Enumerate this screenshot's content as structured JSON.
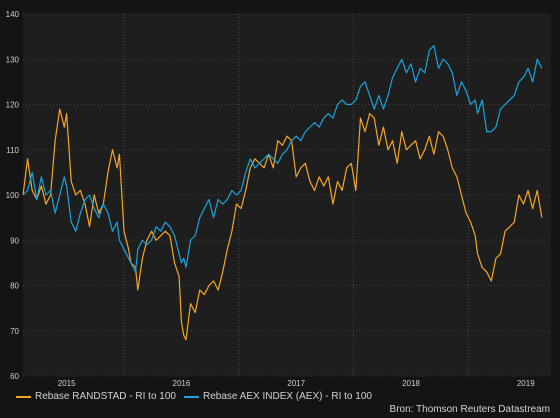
{
  "source_label": "Bron: Thomson Reuters Datastream",
  "chart_data": {
    "type": "line",
    "title": "",
    "xlabel": "",
    "ylabel": "",
    "ylim": [
      60,
      140
    ],
    "yticks": [
      60,
      70,
      80,
      90,
      100,
      110,
      120,
      130,
      140
    ],
    "xlim": [
      2014.62,
      2019.22
    ],
    "year_labels": [
      {
        "x": 2015.0,
        "label": "2015"
      },
      {
        "x": 2016.0,
        "label": "2016"
      },
      {
        "x": 2017.0,
        "label": "2017"
      },
      {
        "x": 2018.0,
        "label": "2018"
      },
      {
        "x": 2019.0,
        "label": "2019"
      }
    ],
    "year_boundaries": [
      2015.5,
      2016.5,
      2017.5,
      2018.5
    ],
    "grid": true,
    "legend_position": "bottom-left",
    "series": [
      {
        "name": "Rebase RANDSTAD - RI to 100",
        "color": "#f5a623",
        "points": [
          [
            2014.62,
            100
          ],
          [
            2014.66,
            108
          ],
          [
            2014.7,
            101
          ],
          [
            2014.74,
            99
          ],
          [
            2014.78,
            102
          ],
          [
            2014.82,
            98
          ],
          [
            2014.86,
            100
          ],
          [
            2014.9,
            112
          ],
          [
            2014.94,
            119
          ],
          [
            2014.98,
            115
          ],
          [
            2015.0,
            118
          ],
          [
            2015.04,
            103
          ],
          [
            2015.08,
            100
          ],
          [
            2015.12,
            101
          ],
          [
            2015.16,
            98
          ],
          [
            2015.2,
            93
          ],
          [
            2015.24,
            100
          ],
          [
            2015.28,
            96
          ],
          [
            2015.32,
            98
          ],
          [
            2015.36,
            105
          ],
          [
            2015.4,
            110
          ],
          [
            2015.44,
            106
          ],
          [
            2015.46,
            109
          ],
          [
            2015.5,
            92
          ],
          [
            2015.54,
            88
          ],
          [
            2015.56,
            85
          ],
          [
            2015.6,
            84
          ],
          [
            2015.62,
            79
          ],
          [
            2015.66,
            86
          ],
          [
            2015.7,
            90
          ],
          [
            2015.74,
            92
          ],
          [
            2015.78,
            90
          ],
          [
            2015.82,
            91
          ],
          [
            2015.86,
            92
          ],
          [
            2015.9,
            91
          ],
          [
            2015.94,
            85
          ],
          [
            2015.98,
            82
          ],
          [
            2016.0,
            72
          ],
          [
            2016.02,
            69
          ],
          [
            2016.04,
            68
          ],
          [
            2016.08,
            76
          ],
          [
            2016.12,
            74
          ],
          [
            2016.16,
            79
          ],
          [
            2016.2,
            78
          ],
          [
            2016.24,
            80
          ],
          [
            2016.28,
            81
          ],
          [
            2016.32,
            79
          ],
          [
            2016.36,
            83
          ],
          [
            2016.4,
            88
          ],
          [
            2016.44,
            92
          ],
          [
            2016.48,
            98
          ],
          [
            2016.52,
            97
          ],
          [
            2016.56,
            101
          ],
          [
            2016.6,
            106
          ],
          [
            2016.64,
            108
          ],
          [
            2016.68,
            107
          ],
          [
            2016.72,
            106
          ],
          [
            2016.76,
            109
          ],
          [
            2016.8,
            106
          ],
          [
            2016.84,
            112
          ],
          [
            2016.88,
            111
          ],
          [
            2016.92,
            113
          ],
          [
            2016.96,
            112
          ],
          [
            2017.0,
            104
          ],
          [
            2017.04,
            106
          ],
          [
            2017.08,
            107
          ],
          [
            2017.12,
            103
          ],
          [
            2017.16,
            101
          ],
          [
            2017.2,
            104
          ],
          [
            2017.24,
            102
          ],
          [
            2017.28,
            104
          ],
          [
            2017.32,
            98
          ],
          [
            2017.36,
            103
          ],
          [
            2017.4,
            101
          ],
          [
            2017.44,
            106
          ],
          [
            2017.48,
            107
          ],
          [
            2017.52,
            101
          ],
          [
            2017.56,
            117
          ],
          [
            2017.6,
            114
          ],
          [
            2017.64,
            118
          ],
          [
            2017.68,
            117
          ],
          [
            2017.72,
            111
          ],
          [
            2017.76,
            115
          ],
          [
            2017.8,
            110
          ],
          [
            2017.84,
            112
          ],
          [
            2017.88,
            107
          ],
          [
            2017.92,
            114
          ],
          [
            2017.96,
            110
          ],
          [
            2018.0,
            111
          ],
          [
            2018.04,
            112
          ],
          [
            2018.08,
            108
          ],
          [
            2018.12,
            110
          ],
          [
            2018.16,
            113
          ],
          [
            2018.2,
            109
          ],
          [
            2018.24,
            114
          ],
          [
            2018.28,
            113
          ],
          [
            2018.32,
            110
          ],
          [
            2018.36,
            106
          ],
          [
            2018.4,
            104
          ],
          [
            2018.44,
            100
          ],
          [
            2018.48,
            96
          ],
          [
            2018.52,
            94
          ],
          [
            2018.56,
            91
          ],
          [
            2018.58,
            87
          ],
          [
            2018.62,
            84
          ],
          [
            2018.66,
            83
          ],
          [
            2018.7,
            81
          ],
          [
            2018.74,
            86
          ],
          [
            2018.78,
            87
          ],
          [
            2018.82,
            92
          ],
          [
            2018.86,
            93
          ],
          [
            2018.9,
            94
          ],
          [
            2018.94,
            100
          ],
          [
            2018.98,
            98
          ],
          [
            2019.02,
            101
          ],
          [
            2019.06,
            97
          ],
          [
            2019.1,
            101
          ],
          [
            2019.14,
            95
          ]
        ]
      },
      {
        "name": "Rebase AEX INDEX (AEX) - RI to 100",
        "color": "#19a3dc",
        "points": [
          [
            2014.62,
            100
          ],
          [
            2014.66,
            101
          ],
          [
            2014.7,
            105
          ],
          [
            2014.74,
            99
          ],
          [
            2014.78,
            104
          ],
          [
            2014.82,
            100
          ],
          [
            2014.86,
            101
          ],
          [
            2014.9,
            96
          ],
          [
            2014.94,
            100
          ],
          [
            2014.98,
            104
          ],
          [
            2015.0,
            102
          ],
          [
            2015.04,
            94
          ],
          [
            2015.08,
            92
          ],
          [
            2015.12,
            96
          ],
          [
            2015.16,
            99
          ],
          [
            2015.2,
            100
          ],
          [
            2015.24,
            97
          ],
          [
            2015.28,
            95
          ],
          [
            2015.32,
            98
          ],
          [
            2015.36,
            96
          ],
          [
            2015.4,
            92
          ],
          [
            2015.44,
            94
          ],
          [
            2015.46,
            90
          ],
          [
            2015.5,
            88
          ],
          [
            2015.54,
            86
          ],
          [
            2015.56,
            85
          ],
          [
            2015.6,
            83
          ],
          [
            2015.62,
            88
          ],
          [
            2015.66,
            90
          ],
          [
            2015.7,
            89
          ],
          [
            2015.74,
            90
          ],
          [
            2015.78,
            93
          ],
          [
            2015.82,
            92
          ],
          [
            2015.86,
            94
          ],
          [
            2015.9,
            93
          ],
          [
            2015.94,
            91
          ],
          [
            2015.98,
            87
          ],
          [
            2016.0,
            85
          ],
          [
            2016.02,
            86
          ],
          [
            2016.04,
            84
          ],
          [
            2016.08,
            90
          ],
          [
            2016.12,
            91
          ],
          [
            2016.16,
            95
          ],
          [
            2016.2,
            97
          ],
          [
            2016.24,
            99
          ],
          [
            2016.28,
            95
          ],
          [
            2016.32,
            99
          ],
          [
            2016.36,
            98
          ],
          [
            2016.4,
            99
          ],
          [
            2016.44,
            101
          ],
          [
            2016.48,
            100
          ],
          [
            2016.52,
            101
          ],
          [
            2016.56,
            105
          ],
          [
            2016.6,
            108
          ],
          [
            2016.64,
            106
          ],
          [
            2016.68,
            107
          ],
          [
            2016.72,
            108
          ],
          [
            2016.76,
            109
          ],
          [
            2016.8,
            108
          ],
          [
            2016.84,
            107
          ],
          [
            2016.88,
            109
          ],
          [
            2016.92,
            110
          ],
          [
            2016.96,
            112
          ],
          [
            2017.0,
            113
          ],
          [
            2017.04,
            112
          ],
          [
            2017.08,
            114
          ],
          [
            2017.12,
            115
          ],
          [
            2017.16,
            116
          ],
          [
            2017.2,
            115
          ],
          [
            2017.24,
            117
          ],
          [
            2017.28,
            118
          ],
          [
            2017.32,
            117
          ],
          [
            2017.36,
            120
          ],
          [
            2017.4,
            121
          ],
          [
            2017.44,
            120
          ],
          [
            2017.48,
            120
          ],
          [
            2017.52,
            121
          ],
          [
            2017.56,
            124
          ],
          [
            2017.6,
            125
          ],
          [
            2017.64,
            122
          ],
          [
            2017.68,
            119
          ],
          [
            2017.72,
            122
          ],
          [
            2017.76,
            119
          ],
          [
            2017.8,
            122
          ],
          [
            2017.84,
            126
          ],
          [
            2017.88,
            128
          ],
          [
            2017.92,
            130
          ],
          [
            2017.96,
            127
          ],
          [
            2018.0,
            129
          ],
          [
            2018.04,
            125
          ],
          [
            2018.08,
            128
          ],
          [
            2018.12,
            127
          ],
          [
            2018.16,
            132
          ],
          [
            2018.2,
            133
          ],
          [
            2018.24,
            128
          ],
          [
            2018.28,
            130
          ],
          [
            2018.32,
            129
          ],
          [
            2018.36,
            127
          ],
          [
            2018.4,
            122
          ],
          [
            2018.44,
            125
          ],
          [
            2018.48,
            123
          ],
          [
            2018.52,
            120
          ],
          [
            2018.56,
            121
          ],
          [
            2018.58,
            118
          ],
          [
            2018.62,
            121
          ],
          [
            2018.66,
            114
          ],
          [
            2018.7,
            114
          ],
          [
            2018.74,
            115
          ],
          [
            2018.78,
            119
          ],
          [
            2018.82,
            120
          ],
          [
            2018.86,
            121
          ],
          [
            2018.9,
            122
          ],
          [
            2018.94,
            125
          ],
          [
            2018.98,
            126
          ],
          [
            2019.02,
            128
          ],
          [
            2019.06,
            125
          ],
          [
            2019.1,
            130
          ],
          [
            2019.14,
            128
          ]
        ]
      }
    ]
  }
}
